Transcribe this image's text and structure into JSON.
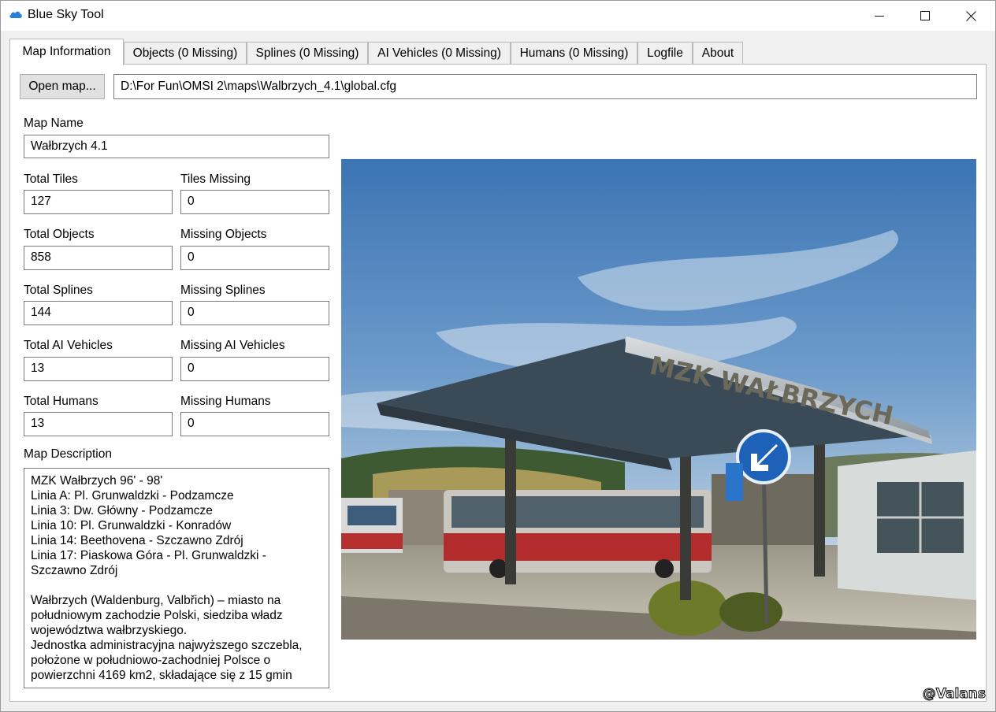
{
  "window": {
    "title": "Blue Sky Tool",
    "icon": "cloud-icon"
  },
  "tabs": [
    {
      "label": "Map Information",
      "active": true
    },
    {
      "label": "Objects (0 Missing)",
      "active": false
    },
    {
      "label": "Splines (0 Missing)",
      "active": false
    },
    {
      "label": "AI Vehicles (0 Missing)",
      "active": false
    },
    {
      "label": "Humans (0 Missing)",
      "active": false
    },
    {
      "label": "Logfile",
      "active": false
    },
    {
      "label": "About",
      "active": false
    }
  ],
  "map_info": {
    "open_button_label": "Open map...",
    "path": "D:\\For Fun\\OMSI 2\\maps\\Walbrzych_4.1\\global.cfg",
    "map_name_label": "Map Name",
    "map_name": "Wałbrzych 4.1",
    "total_tiles_label": "Total Tiles",
    "total_tiles": "127",
    "tiles_missing_label": "Tiles Missing",
    "tiles_missing": "0",
    "total_objects_label": "Total Objects",
    "total_objects": "858",
    "missing_objects_label": "Missing Objects",
    "missing_objects": "0",
    "total_splines_label": "Total Splines",
    "total_splines": "144",
    "missing_splines_label": "Missing Splines",
    "missing_splines": "0",
    "total_ai_label": "Total AI Vehicles",
    "total_ai": "13",
    "missing_ai_label": "Missing AI Vehicles",
    "missing_ai": "0",
    "total_humans_label": "Total Humans",
    "total_humans": "13",
    "missing_humans_label": "Missing Humans",
    "missing_humans": "0",
    "description_label": "Map Description",
    "description_lines": [
      "MZK Wałbrzych 96' - 98'",
      "Linia A: Pl. Grunwaldzki - Podzamcze",
      "Linia 3: Dw. Główny - Podzamcze",
      "Linia 10: Pl. Grunwaldzki - Konradów",
      "Linia 14: Beethovena - Szczawno Zdrój",
      "Linia 17: Piaskowa Góra - Pl. Grunwaldzki -",
      "Szczawno Zdrój",
      "",
      "Wałbrzych (Waldenburg, Valbřich) – miasto na",
      "południowym zachodzie Polski, siedziba władz",
      "województwa wałbrzyskiego.",
      "Jednostka administracyjna najwyższego szczebla,",
      "położone w południowo-zachodniej Polsce o",
      "powierzchni 4169 km2, składające się z 15 gmin"
    ]
  },
  "photo": {
    "sign_text": "MZK WAŁBRZYCH"
  },
  "watermark": "@Valans",
  "colors": {
    "panel_bg": "#f0f0f0",
    "sky_top": "#3f78b8",
    "sky_bottom": "#b5cde0",
    "canopy": "#3a4a58",
    "sign_blue": "#1d62b8",
    "bus_red": "#b32c2c"
  }
}
